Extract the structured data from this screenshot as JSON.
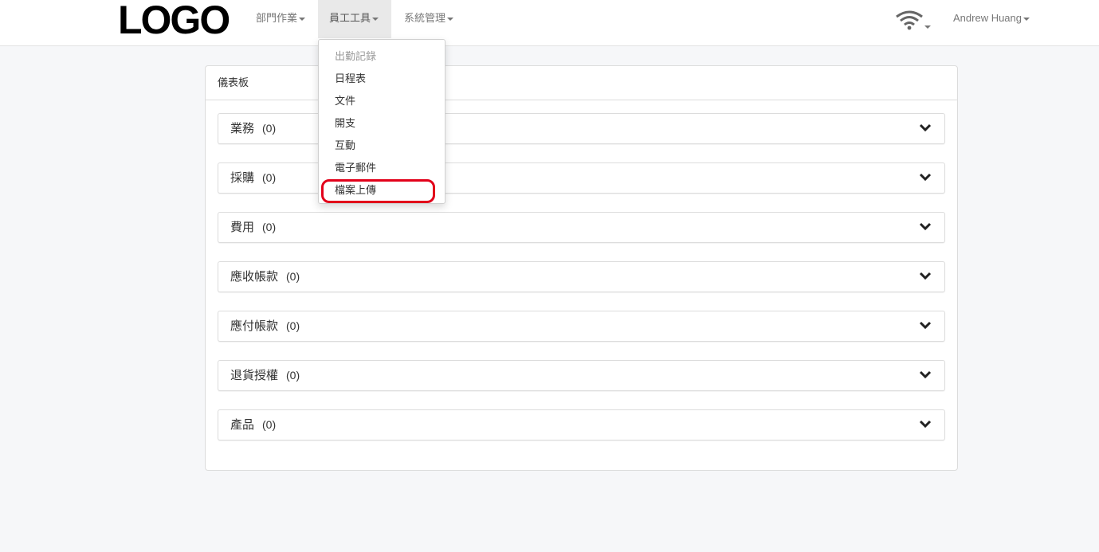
{
  "navbar": {
    "logo": "LOGO",
    "menus": [
      {
        "label": "部門作業"
      },
      {
        "label": "員工工具"
      },
      {
        "label": "系統管理"
      }
    ],
    "user": "Andrew Huang"
  },
  "dropdown": {
    "items": [
      {
        "label": "出勤記錄",
        "disabled": true
      },
      {
        "label": "日程表"
      },
      {
        "label": "文件"
      },
      {
        "label": "開支"
      },
      {
        "label": "互動"
      },
      {
        "label": "電子郵件"
      },
      {
        "label": "檔案上傳",
        "highlighted": true
      }
    ]
  },
  "dashboard": {
    "title": "儀表板",
    "sections": [
      {
        "label": "業務",
        "count": "(0)"
      },
      {
        "label": "採購",
        "count": "(0)"
      },
      {
        "label": "費用",
        "count": "(0)"
      },
      {
        "label": "應收帳款",
        "count": "(0)"
      },
      {
        "label": "應付帳款",
        "count": "(0)"
      },
      {
        "label": "退貨授權",
        "count": "(0)"
      },
      {
        "label": "產品",
        "count": "(0)"
      }
    ]
  },
  "colors": {
    "highlight": "#e2001a",
    "nav_active_bg": "#e9e9e9",
    "page_bg": "#f6f7f9"
  }
}
